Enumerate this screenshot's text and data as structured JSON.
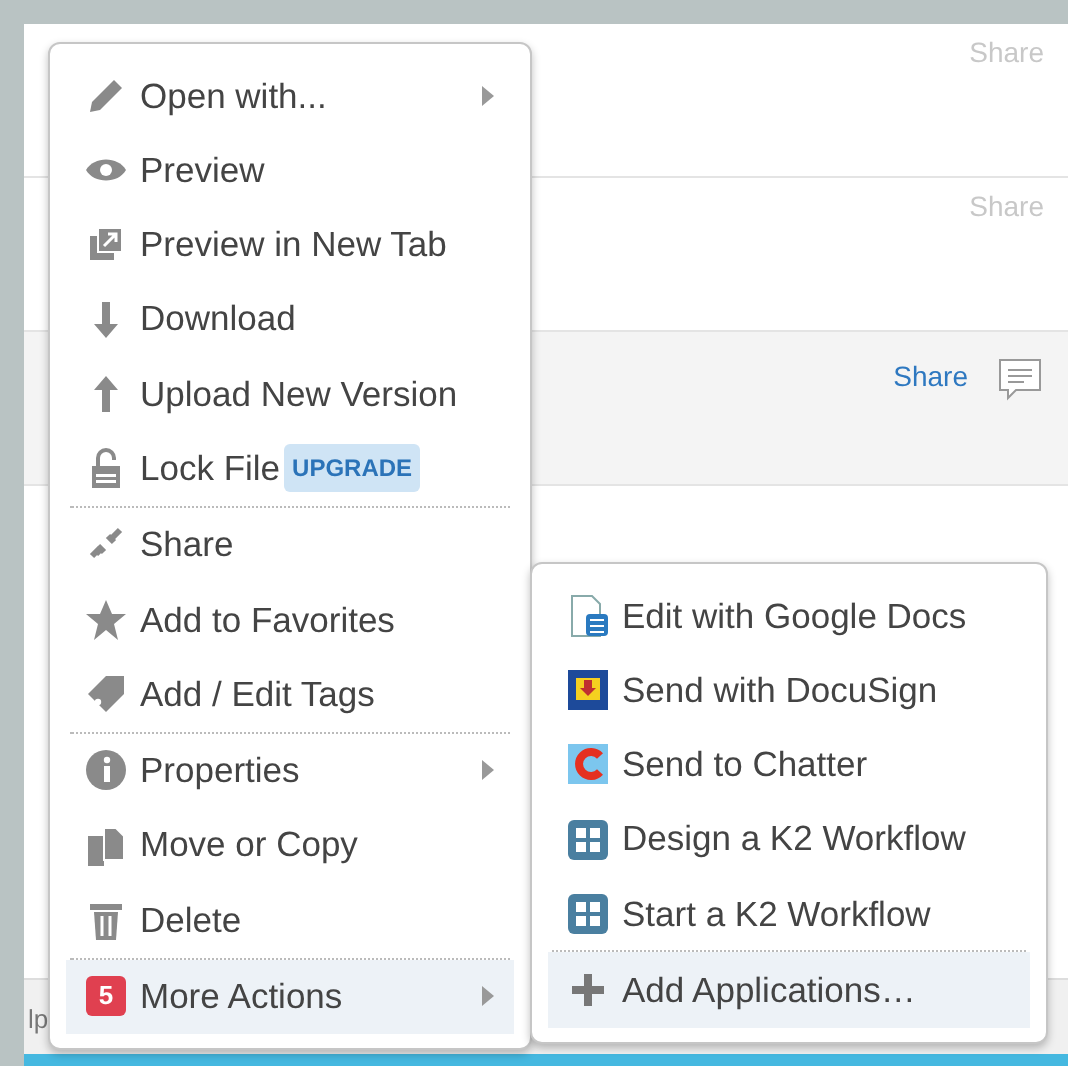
{
  "background": {
    "rows": [
      {
        "share": "Share",
        "highlighted": false,
        "comment": false
      },
      {
        "share": "Share",
        "highlighted": false,
        "comment": false
      },
      {
        "share": "Share",
        "highlighted": true,
        "comment": true
      }
    ],
    "footer_fragment": "lp"
  },
  "menu": {
    "groups": [
      [
        {
          "label": "Open with...",
          "has_submenu": true,
          "selected": false
        },
        {
          "label": "Preview",
          "has_submenu": false,
          "selected": false
        },
        {
          "label": "Preview in New Tab",
          "has_submenu": false,
          "selected": false
        },
        {
          "label": "Download",
          "has_submenu": false,
          "selected": false
        },
        {
          "label": "Upload New Version",
          "has_submenu": false,
          "selected": false
        },
        {
          "label": "Lock File",
          "badge": "UPGRADE",
          "has_submenu": false,
          "selected": false
        }
      ],
      [
        {
          "label": "Share",
          "has_submenu": false,
          "selected": false
        },
        {
          "label": "Add to Favorites",
          "has_submenu": false,
          "selected": false
        },
        {
          "label": "Add / Edit Tags",
          "has_submenu": false,
          "selected": false
        }
      ],
      [
        {
          "label": "Properties",
          "has_submenu": true,
          "selected": false
        },
        {
          "label": "Move or Copy",
          "has_submenu": false,
          "selected": false
        },
        {
          "label": "Delete",
          "has_submenu": false,
          "selected": false
        }
      ],
      [
        {
          "label": "More Actions",
          "count": "5",
          "has_submenu": true,
          "selected": true
        }
      ]
    ]
  },
  "submenu": {
    "groups": [
      [
        {
          "label": "Edit with Google Docs",
          "selected": false
        },
        {
          "label": "Send with DocuSign",
          "selected": false
        },
        {
          "label": "Send to Chatter",
          "selected": false
        },
        {
          "label": "Design a K2 Workflow",
          "selected": false
        },
        {
          "label": "Start a K2 Workflow",
          "selected": false
        }
      ],
      [
        {
          "label": "Add Applications…",
          "selected": true
        }
      ]
    ]
  }
}
